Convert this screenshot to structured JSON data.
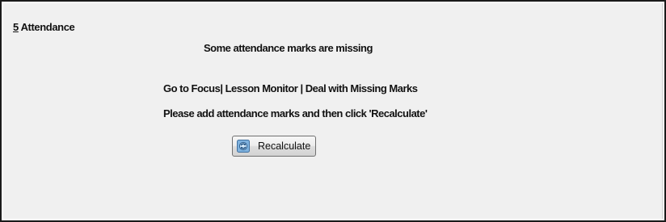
{
  "section": {
    "number": "5",
    "title": " Attendance"
  },
  "messages": {
    "missing": "Some attendance marks are missing",
    "goto": "Go to Focus| Lesson Monitor | Deal with Missing Marks",
    "instruction": "Please add attendance marks and then click 'Recalculate'"
  },
  "button": {
    "label": "Recalculate",
    "icon": "recalculate-icon"
  }
}
